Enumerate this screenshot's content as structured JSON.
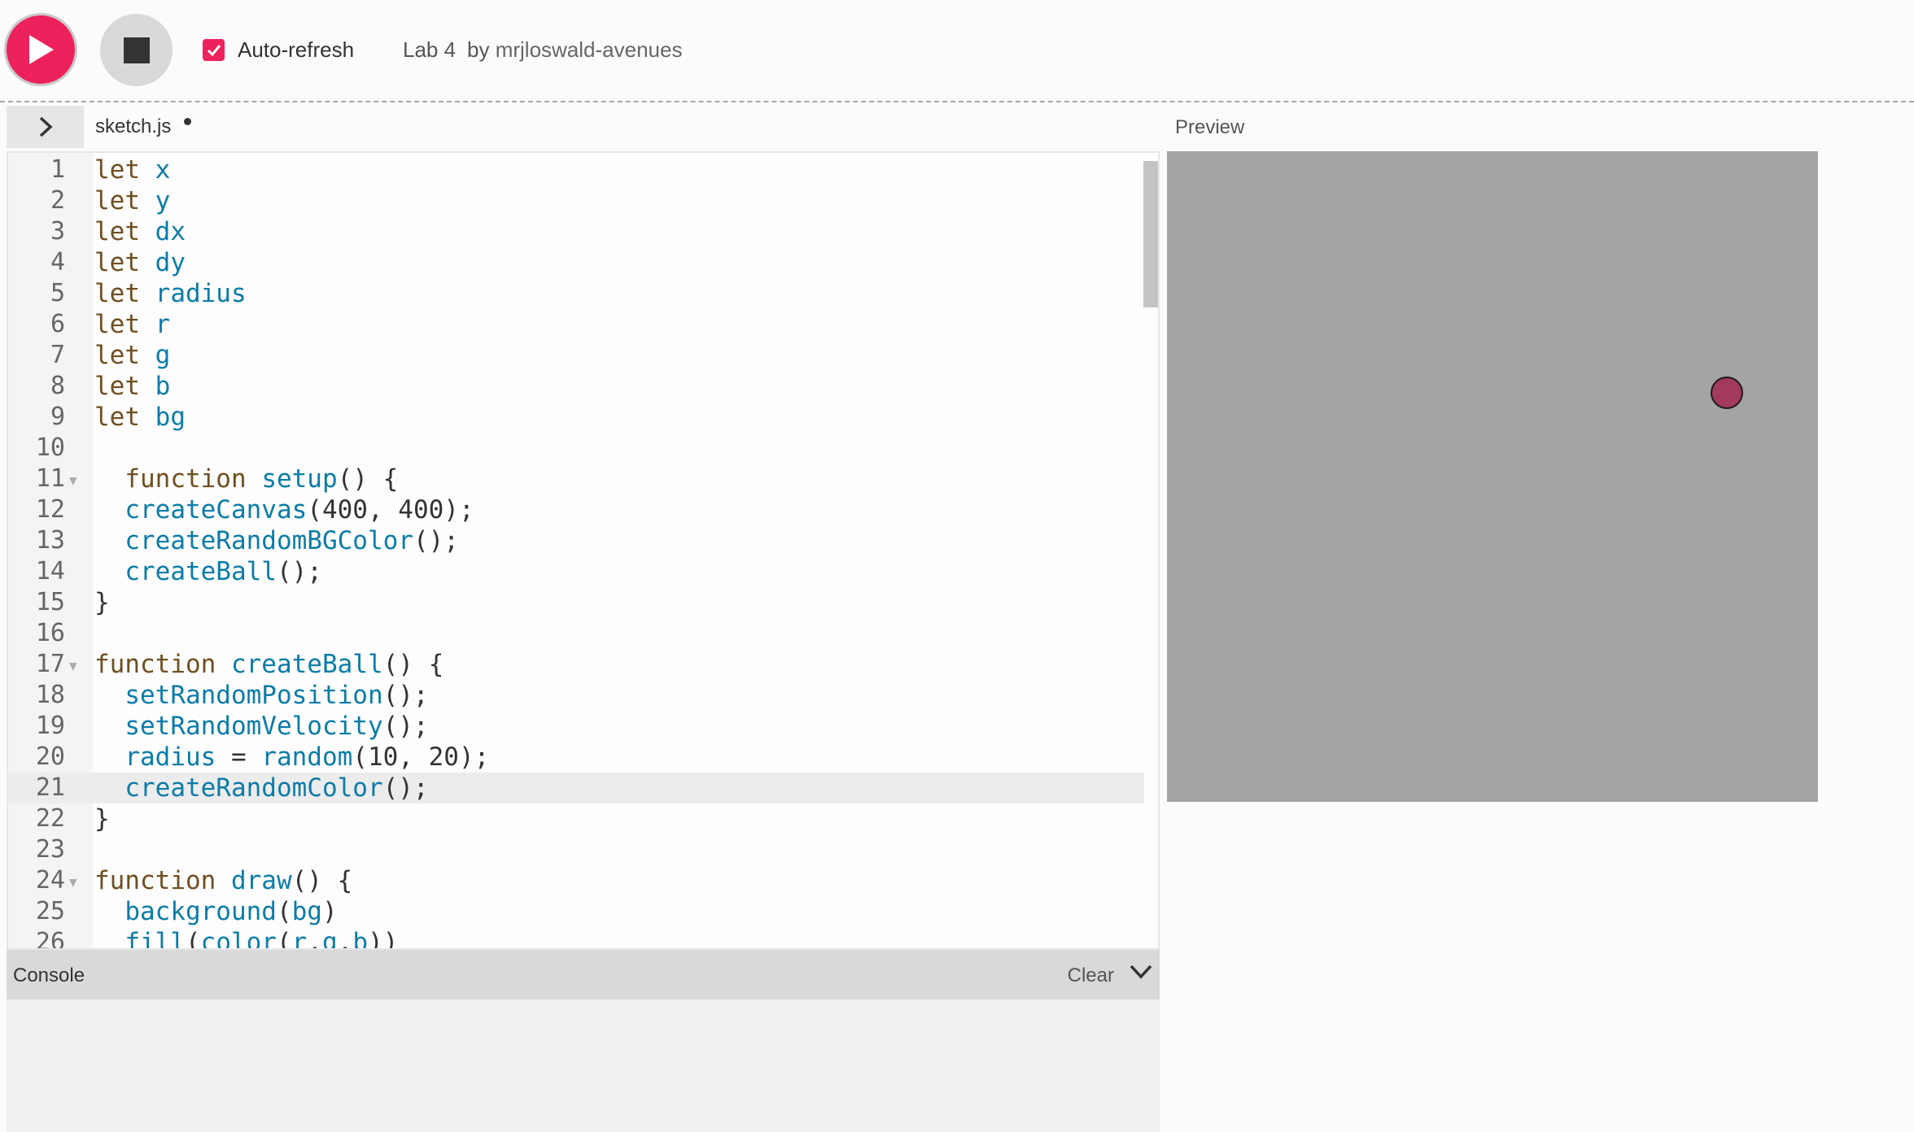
{
  "toolbar": {
    "auto_refresh_label": "Auto-refresh",
    "auto_refresh_checked": true,
    "project_name": "Lab 4",
    "owner_prefix": "by",
    "owner_name": "mrjloswald-avenues",
    "accent_color": "#ed225d"
  },
  "editor": {
    "file_name": "sketch.js",
    "unsaved": true,
    "active_line": 21,
    "lines": [
      {
        "n": "1",
        "fold": false,
        "tokens": [
          [
            "kw",
            "let "
          ],
          [
            "id",
            "x"
          ]
        ]
      },
      {
        "n": "2",
        "fold": false,
        "tokens": [
          [
            "kw",
            "let "
          ],
          [
            "id",
            "y"
          ]
        ]
      },
      {
        "n": "3",
        "fold": false,
        "tokens": [
          [
            "kw",
            "let "
          ],
          [
            "id",
            "dx"
          ]
        ]
      },
      {
        "n": "4",
        "fold": false,
        "tokens": [
          [
            "kw",
            "let "
          ],
          [
            "id",
            "dy"
          ]
        ]
      },
      {
        "n": "5",
        "fold": false,
        "tokens": [
          [
            "kw",
            "let "
          ],
          [
            "id",
            "radius"
          ]
        ]
      },
      {
        "n": "6",
        "fold": false,
        "tokens": [
          [
            "kw",
            "let "
          ],
          [
            "id",
            "r"
          ]
        ]
      },
      {
        "n": "7",
        "fold": false,
        "tokens": [
          [
            "kw",
            "let "
          ],
          [
            "id",
            "g"
          ]
        ]
      },
      {
        "n": "8",
        "fold": false,
        "tokens": [
          [
            "kw",
            "let "
          ],
          [
            "id",
            "b"
          ]
        ]
      },
      {
        "n": "9",
        "fold": false,
        "tokens": [
          [
            "kw",
            "let "
          ],
          [
            "id",
            "bg"
          ]
        ]
      },
      {
        "n": "10",
        "fold": false,
        "tokens": []
      },
      {
        "n": "11",
        "fold": true,
        "tokens": [
          [
            "pn",
            "  "
          ],
          [
            "kw",
            "function "
          ],
          [
            "id",
            "setup"
          ],
          [
            "pn",
            "() {"
          ]
        ]
      },
      {
        "n": "12",
        "fold": false,
        "tokens": [
          [
            "pn",
            "  "
          ],
          [
            "id",
            "createCanvas"
          ],
          [
            "pn",
            "("
          ],
          [
            "nm",
            "400"
          ],
          [
            "pn",
            ", "
          ],
          [
            "nm",
            "400"
          ],
          [
            "pn",
            ");"
          ]
        ]
      },
      {
        "n": "13",
        "fold": false,
        "tokens": [
          [
            "pn",
            "  "
          ],
          [
            "id",
            "createRandomBGColor"
          ],
          [
            "pn",
            "();"
          ]
        ]
      },
      {
        "n": "14",
        "fold": false,
        "tokens": [
          [
            "pn",
            "  "
          ],
          [
            "id",
            "createBall"
          ],
          [
            "pn",
            "();"
          ]
        ]
      },
      {
        "n": "15",
        "fold": false,
        "tokens": [
          [
            "pn",
            "}"
          ]
        ]
      },
      {
        "n": "16",
        "fold": false,
        "tokens": []
      },
      {
        "n": "17",
        "fold": true,
        "tokens": [
          [
            "kw",
            "function "
          ],
          [
            "id",
            "createBall"
          ],
          [
            "pn",
            "() {"
          ]
        ]
      },
      {
        "n": "18",
        "fold": false,
        "tokens": [
          [
            "pn",
            "  "
          ],
          [
            "id",
            "setRandomPosition"
          ],
          [
            "pn",
            "();"
          ]
        ]
      },
      {
        "n": "19",
        "fold": false,
        "tokens": [
          [
            "pn",
            "  "
          ],
          [
            "id",
            "setRandomVelocity"
          ],
          [
            "pn",
            "();"
          ]
        ]
      },
      {
        "n": "20",
        "fold": false,
        "tokens": [
          [
            "pn",
            "  "
          ],
          [
            "id",
            "radius"
          ],
          [
            "pn",
            " = "
          ],
          [
            "id",
            "random"
          ],
          [
            "pn",
            "("
          ],
          [
            "nm",
            "10"
          ],
          [
            "pn",
            ", "
          ],
          [
            "nm",
            "20"
          ],
          [
            "pn",
            ");"
          ]
        ]
      },
      {
        "n": "21",
        "fold": false,
        "tokens": [
          [
            "pn",
            "  "
          ],
          [
            "id",
            "createRandomColor"
          ],
          [
            "pn",
            "();"
          ]
        ]
      },
      {
        "n": "22",
        "fold": false,
        "tokens": [
          [
            "pn",
            "}"
          ]
        ]
      },
      {
        "n": "23",
        "fold": false,
        "tokens": []
      },
      {
        "n": "24",
        "fold": true,
        "tokens": [
          [
            "kw",
            "function "
          ],
          [
            "id",
            "draw"
          ],
          [
            "pn",
            "() {"
          ]
        ]
      },
      {
        "n": "25",
        "fold": false,
        "tokens": [
          [
            "pn",
            "  "
          ],
          [
            "id",
            "background"
          ],
          [
            "pn",
            "("
          ],
          [
            "id",
            "bg"
          ],
          [
            "pn",
            ")"
          ]
        ]
      },
      {
        "n": "26",
        "fold": false,
        "tokens": [
          [
            "pn",
            "  "
          ],
          [
            "id",
            "fill"
          ],
          [
            "pn",
            "("
          ],
          [
            "id",
            "color"
          ],
          [
            "pn",
            "("
          ],
          [
            "id",
            "r"
          ],
          [
            "pn",
            ","
          ],
          [
            "id",
            "g"
          ],
          [
            "pn",
            ","
          ],
          [
            "id",
            "b"
          ],
          [
            "pn",
            "))"
          ]
        ]
      }
    ]
  },
  "console": {
    "title": "Console",
    "clear_label": "Clear"
  },
  "preview": {
    "label": "Preview",
    "canvas_color": "#a4a3a6",
    "ball_color": "#a3395e"
  }
}
